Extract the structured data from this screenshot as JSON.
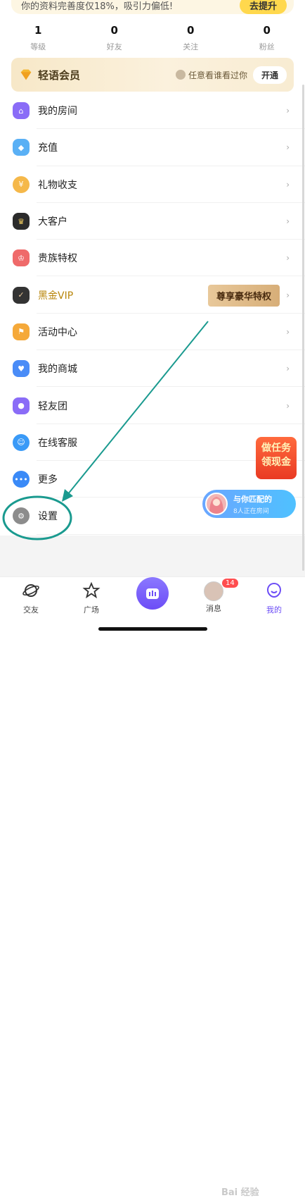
{
  "profile": {
    "completeness_text": "你的资料完善度仅18%，吸引力偏低!",
    "improve_button": "去提升"
  },
  "stats": [
    {
      "value": "1",
      "label": "等级"
    },
    {
      "value": "0",
      "label": "好友"
    },
    {
      "value": "0",
      "label": "关注"
    },
    {
      "value": "0",
      "label": "粉丝"
    }
  ],
  "vip": {
    "title": "轻语会员",
    "feature": "任意看谁看过你",
    "open_button": "开通"
  },
  "menu": [
    {
      "label": "我的房间",
      "icon": "house-icon",
      "color": "#8a6cf7"
    },
    {
      "label": "充值",
      "icon": "diamond-icon",
      "color": "#5ab0f5"
    },
    {
      "label": "礼物收支",
      "icon": "coin-icon",
      "color": "#f5b84a"
    },
    {
      "label": "大客户",
      "icon": "crown-icon",
      "color": "#2b2b2b"
    },
    {
      "label": "贵族特权",
      "icon": "crown-badge-icon",
      "color": "#ef6a6a"
    },
    {
      "label": "黑金VIP",
      "icon": "vip-icon",
      "color": "#333333",
      "tag": "尊享豪华特权"
    },
    {
      "label": "活动中心",
      "icon": "flag-icon",
      "color": "#f5a93a"
    },
    {
      "label": "我的商城",
      "icon": "shop-bag-icon",
      "color": "#4a8cf7"
    },
    {
      "label": "轻友团",
      "icon": "group-icon",
      "color": "#8a6cf7"
    },
    {
      "label": "在线客服",
      "icon": "support-chat-icon",
      "color": "#3a9af7"
    },
    {
      "label": "更多",
      "icon": "more-dots-icon",
      "color": "#3a8af7"
    },
    {
      "label": "设置",
      "icon": "gear-icon",
      "color": "#8c8c8c"
    }
  ],
  "chevron": "›",
  "floats": {
    "task_line1": "做任务",
    "task_line2": "领现金",
    "match_title": "与你匹配的",
    "match_sub": "8人正在房间"
  },
  "tabs": [
    {
      "label": "交友",
      "icon": "planet-icon"
    },
    {
      "label": "广场",
      "icon": "star-icon"
    },
    {
      "label": "消息",
      "icon": "avatar-message-icon",
      "badge": "14"
    },
    {
      "label": "我的",
      "icon": "profile-icon",
      "active": true
    }
  ],
  "watermark": "Bai 经验"
}
